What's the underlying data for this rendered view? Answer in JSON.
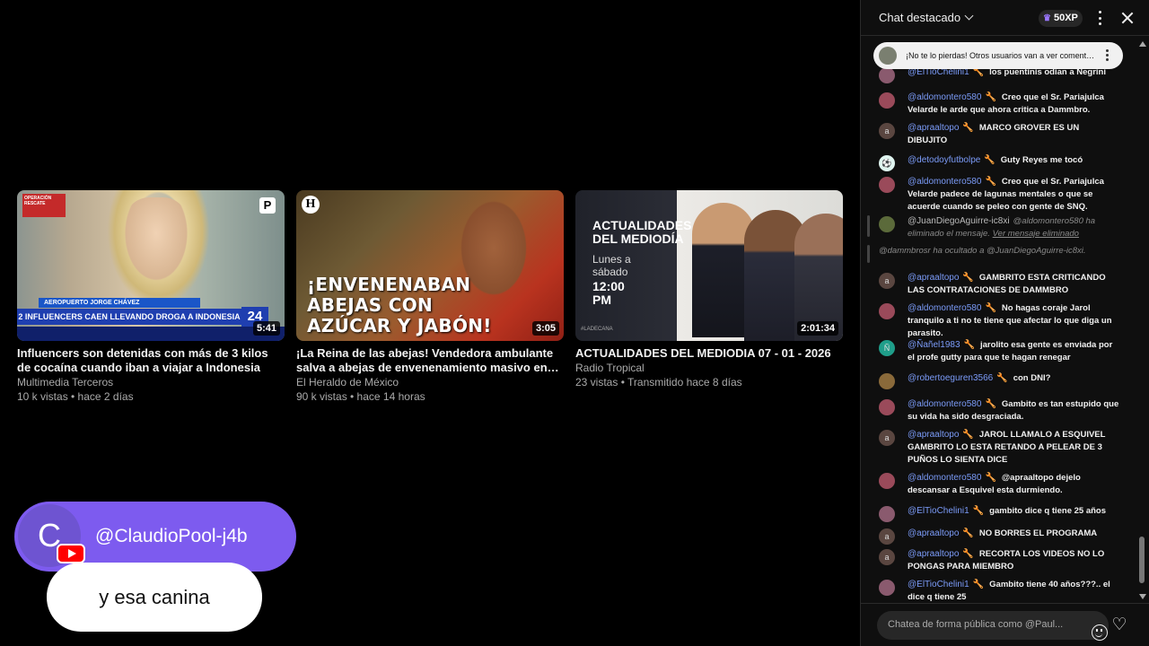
{
  "videos": [
    {
      "title": "Influencers son detenidas con más de 3 kilos de cocaína cuando iban a viajar a Indonesia",
      "channel": "Multimedia Terceros",
      "stats": "10 k vistas • hace 2 días",
      "duration": "5:41",
      "overlay_badge": "OPERACIÓN RESCATE",
      "overlay_bar1": "AEROPUERTO JORGE CHÁVEZ",
      "overlay_bar2": "2 INFLUENCERS CAEN LLEVANDO DROGA A INDONESIA",
      "overlay_channel": "24",
      "overlay_logo": "P"
    },
    {
      "title": "¡La Reina de las abejas! Vendedora ambulante salva a abejas de envenenamiento masivo en La...",
      "channel": "El Heraldo de México",
      "stats": "90 k vistas • hace 14 horas",
      "duration": "3:05",
      "overlay_logo": "H",
      "overlay_text": "¡ENVENENABAN ABEJAS CON AZÚCAR Y JABÓN!"
    },
    {
      "title": "ACTUALIDADES DEL MEDIODIA 07 - 01 - 2026",
      "channel": "Radio Tropical",
      "stats": "23 vistas • Transmitido hace 8 días",
      "duration": "2:01:34",
      "overlay_heading": "ACTUALIDADES DEL MEDIODÍA",
      "overlay_sub": "Lunes a sábado",
      "overlay_time": "12:00 PM",
      "overlay_tag": "#LADECANA"
    }
  ],
  "overlay": {
    "avatar_letter": "C",
    "username": "@ClaudioPool-j4b",
    "message": "y esa canina"
  },
  "chat": {
    "title": "Chat destacado",
    "xp": "50XP",
    "pinned": "¡No te lo pierdas! Otros usuarios van a ver comentarios destacados",
    "input_placeholder": "Chatea de forma pública como @Paul...",
    "messages": [
      {
        "author": "@ElTioChelini1",
        "text": "los puentinis odian a Negrini",
        "avatar": "",
        "avatar_color": "#8a5a6e"
      },
      {
        "author": "@aldomontero580",
        "text": "Creo que el Sr. Pariajulca Velarde le arde que ahora critica a Dammbro.",
        "avatar": "",
        "avatar_color": "#9a4a5a"
      },
      {
        "author": "@apraaltopo",
        "text": "MARCO GROVER ES UN DIBUJITO",
        "avatar": "a",
        "avatar_color": "#5a4640"
      },
      {
        "author": "@detodoyfutbolpe",
        "text": "Guty Reyes me tocó",
        "avatar": "⚽",
        "avatar_color": "#e0f5f0"
      },
      {
        "author": "@aldomontero580",
        "text": "Creo que el Sr. Pariajulca Velarde padece de lagunas mentales o que se acuerde cuando se peleo con gente de SNQ.",
        "avatar": "",
        "avatar_color": "#9a4a5a"
      },
      {
        "author": "@JuanDiegoAguirre-ic8xi",
        "text": "@aldomontero580 ha eliminado el mensaje.",
        "link": "Ver mensaje eliminado",
        "avatar": "",
        "avatar_color": "#5b6a3a"
      },
      {
        "system": "@dammbrosr ha ocultado a @JuanDiegoAguirre-ic8xi."
      },
      {
        "author": "@apraaltopo",
        "text": "GAMBRITO ESTA CRITICANDO LAS CONTRATACIONES DE DAMMBRO",
        "avatar": "a",
        "avatar_color": "#5a4640"
      },
      {
        "author": "@aldomontero580",
        "text": "No hagas coraje Jarol tranquilo a ti no te tiene que afectar lo que diga un parasito.",
        "avatar": "",
        "avatar_color": "#9a4a5a"
      },
      {
        "author": "@Ñañel1983",
        "text": "jarolito esa gente es enviada por el profe gutty para que te hagan renegar",
        "avatar": "Ñ",
        "avatar_color": "#1f9e8a"
      },
      {
        "author": "@robertoeguren3566",
        "text": "con DNI?",
        "avatar": "",
        "avatar_color": "#8a6a3a"
      },
      {
        "author": "@aldomontero580",
        "text": "Gambito es tan estupido que su vida ha sido desgraciada.",
        "avatar": "",
        "avatar_color": "#9a4a5a"
      },
      {
        "author": "@apraaltopo",
        "text": "JAROL LLAMALO A ESQUIVEL GAMBRITO LO ESTA RETANDO A PELEAR DE 3 PUÑOS LO SIENTA DICE",
        "avatar": "a",
        "avatar_color": "#5a4640"
      },
      {
        "author": "@aldomontero580",
        "text": "@apraaltopo dejelo descansar a Esquivel esta durmiendo.",
        "avatar": "",
        "avatar_color": "#9a4a5a"
      },
      {
        "author": "@ElTioChelini1",
        "text": "gambito dice q tiene 25 años",
        "avatar": "",
        "avatar_color": "#8a5a6e"
      },
      {
        "author": "@apraaltopo",
        "text": "NO BORRES EL PROGRAMA",
        "avatar": "a",
        "avatar_color": "#5a4640"
      },
      {
        "author": "@apraaltopo",
        "text": "RECORTA LOS VIDEOS NO LO PONGAS PARA MIEMBRO",
        "avatar": "a",
        "avatar_color": "#5a4640"
      },
      {
        "author": "@ElTioChelini1",
        "text": "Gambito tiene 40 años???.. el dice q tiene 25",
        "avatar": "",
        "avatar_color": "#8a5a6e"
      }
    ]
  },
  "colors": {
    "accent_purple": "#7d5bef",
    "author_blue": "#7b9bf8",
    "youtube_red": "#ff0000"
  }
}
